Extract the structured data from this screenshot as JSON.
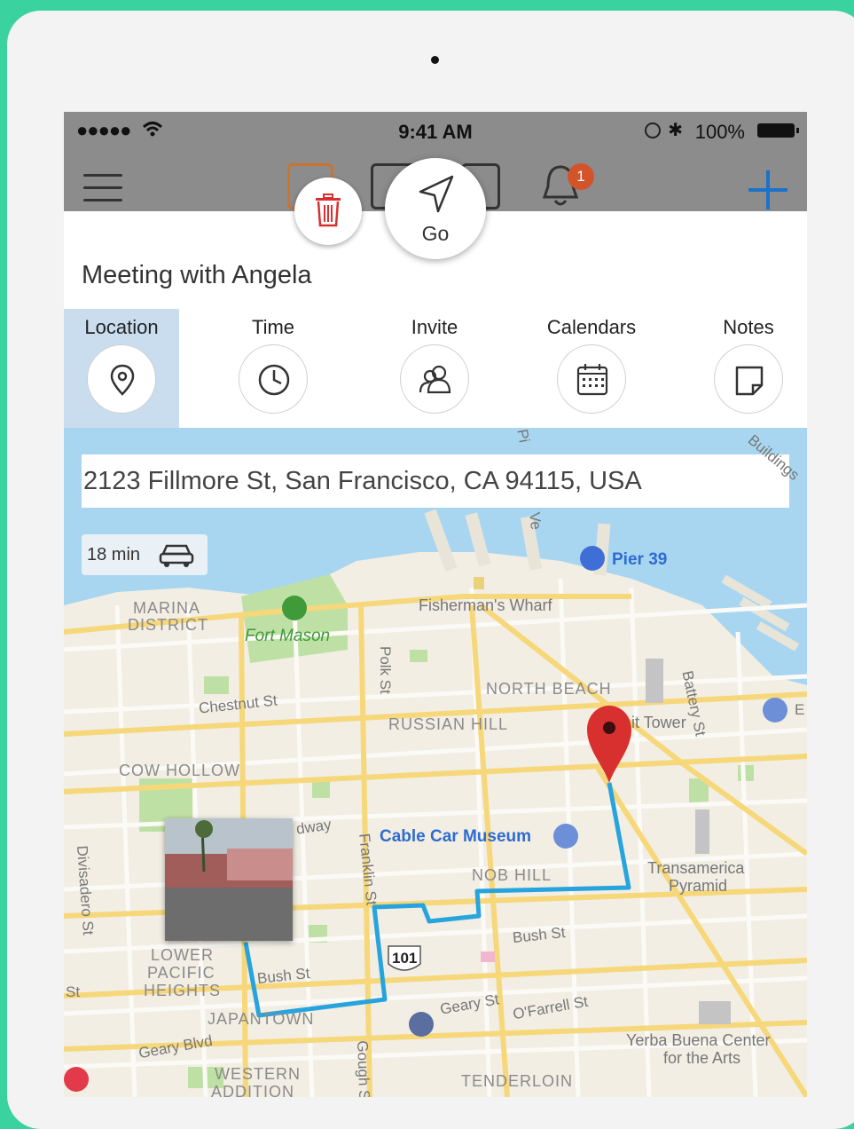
{
  "status_bar": {
    "signal": "●●●●●",
    "time": "9:41 AM",
    "battery": "100%"
  },
  "nav": {
    "notification_count": "1"
  },
  "floating": {
    "go_label": "Go"
  },
  "event": {
    "title": "Meeting with Angela"
  },
  "tabs": [
    {
      "label": "Location",
      "icon": "location-pin-icon",
      "active": true
    },
    {
      "label": "Time",
      "icon": "clock-icon",
      "active": false
    },
    {
      "label": "Invite",
      "icon": "people-icon",
      "active": false
    },
    {
      "label": "Calendars",
      "icon": "calendar-icon",
      "active": false
    },
    {
      "label": "Notes",
      "icon": "note-icon",
      "active": false
    }
  ],
  "map": {
    "address": "2123 Fillmore St, San Francisco, CA 94115, USA",
    "eta": "18 min",
    "labels": {
      "pier39": "Pier 39",
      "marina1": "MARINA",
      "marina2": "DISTRICT",
      "fort_mason": "Fort Mason",
      "fishermans": "Fisherman's Wharf",
      "north_beach": "NORTH BEACH",
      "russian_hill": "RUSSIAN HILL",
      "chestnut": "Chestnut St",
      "cow_hollow": "COW HOLLOW",
      "coit": "it Tower",
      "battery": "Battery St",
      "polk": "Polk St",
      "cable_car": "Cable Car Museum",
      "nob_hill": "NOB HILL",
      "transamerica1": "Transamerica",
      "transamerica2": "Pyramid",
      "divisadero": "Divisadero St",
      "franklin": "Franklin St",
      "broadway": "dway",
      "bush1": "Bush St",
      "bush2": "Bush St",
      "lower1": "LOWER",
      "lower2": "PACIFIC",
      "lower3": "HEIGHTS",
      "japantown": "JAPANTOWN",
      "geary_blvd": "Geary Blvd",
      "geary_st": "Geary St",
      "ofarrell": "O'Farrell St",
      "gough": "Gough St",
      "western1": "WESTERN",
      "western2": "ADDITION",
      "tenderloin": "TENDERLOIN",
      "yerba1": "Yerba Buena Center",
      "yerba2": "for the Arts",
      "hwy101": "101",
      "st_left": "St",
      "e_right": "E",
      "pi": "Pi",
      "ve": "Ve",
      "building": "Buildings"
    }
  },
  "colors": {
    "accent_blue": "#1a73c9",
    "route": "#27a4dd",
    "pin": "#d8302e",
    "water": "#a8d6f0",
    "park": "#bfe0a5",
    "road": "#f6d77a"
  }
}
